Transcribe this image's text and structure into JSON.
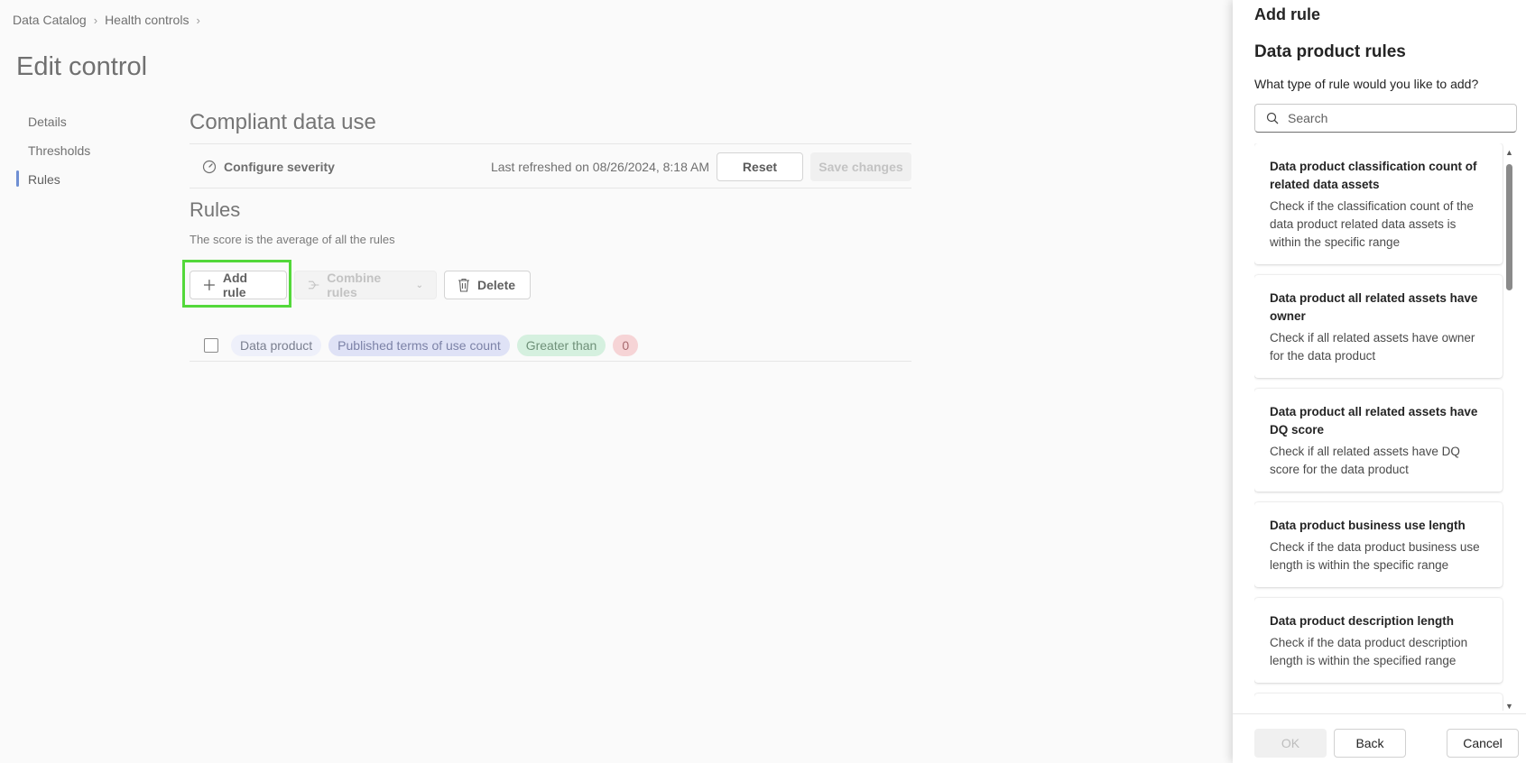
{
  "breadcrumb": {
    "items": [
      "Data Catalog",
      "Health controls"
    ]
  },
  "page": {
    "title": "Edit control"
  },
  "sidenav": {
    "items": [
      {
        "label": "Details"
      },
      {
        "label": "Thresholds"
      },
      {
        "label": "Rules",
        "active": true
      }
    ]
  },
  "section": {
    "title": "Compliant data use",
    "configure_severity": "Configure severity",
    "last_refreshed": "Last refreshed on 08/26/2024, 8:18 AM",
    "reset": "Reset",
    "save_changes": "Save changes"
  },
  "rules": {
    "title": "Rules",
    "subtitle": "The score is the average of all the rules",
    "toolbar": {
      "add_rule": "Add rule",
      "combine_rules": "Combine rules",
      "delete": "Delete"
    },
    "rows": [
      {
        "chips": [
          "Data product",
          "Published terms of use count",
          "Greater than",
          "0"
        ]
      }
    ]
  },
  "panel": {
    "title": "Add rule",
    "heading": "Data product rules",
    "question": "What type of rule would you like to add?",
    "search_placeholder": "Search",
    "cards": [
      {
        "title": "Data product classification count of related data assets",
        "desc": "Check if the classification count of the data product related data assets is within the specific range"
      },
      {
        "title": "Data product all related assets have owner",
        "desc": "Check if all related assets have owner for the data product"
      },
      {
        "title": "Data product all related assets have DQ score",
        "desc": "Check if all related assets have DQ score for the data product"
      },
      {
        "title": "Data product business use length",
        "desc": "Check if the data product business use length is within the specific range"
      },
      {
        "title": "Data product description length",
        "desc": "Check if the data product description length is within the specified range"
      }
    ],
    "footer": {
      "ok": "OK",
      "back": "Back",
      "cancel": "Cancel"
    }
  },
  "colors": {
    "highlight": "#53d83a",
    "active_nav": "#6f8fd3"
  }
}
